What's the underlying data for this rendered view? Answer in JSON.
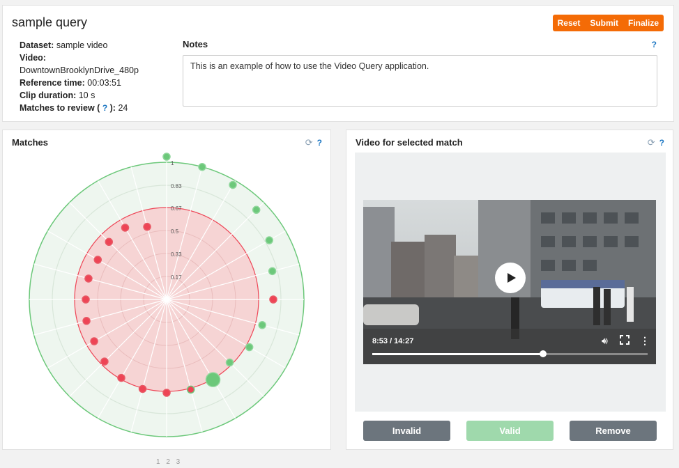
{
  "header": {
    "title": "sample query",
    "buttons": [
      "Reset",
      "Submit",
      "Finalize"
    ],
    "button_color": "#f46b06"
  },
  "meta": {
    "dataset_label": "Dataset:",
    "dataset_value": "sample video",
    "video_label": "Video:",
    "video_value": "DowntownBrooklynDrive_480p",
    "reference_label": "Reference time:",
    "reference_value": "00:03:51",
    "clip_label": "Clip duration:",
    "clip_value": "10 s",
    "matches_label_start": "Matches to review (",
    "matches_help": "?",
    "matches_label_end": "):",
    "matches_value": "24"
  },
  "notes": {
    "label": "Notes",
    "help": "?",
    "text": "This is an example of how to use the Video Query application."
  },
  "matches_panel": {
    "title": "Matches",
    "help": "?",
    "radial_labels": [
      "1",
      "0.83",
      "0.67",
      "0.5",
      "0.33",
      "0.17"
    ],
    "pages": "1 2 3",
    "colors": {
      "valid": "#6cc87a",
      "invalid": "#ee4455",
      "valid_fill": "#eef6ef",
      "invalid_fill": "#f6d4d4"
    }
  },
  "video_panel": {
    "title": "Video for selected match",
    "help": "?",
    "time_display": "8:53 / 14:27",
    "progress": 0.62,
    "buttons": {
      "invalid": "Invalid",
      "valid": "Valid",
      "remove": "Remove"
    },
    "colors": {
      "invalid": "#6c757d",
      "valid": "#9fd9ac",
      "remove": "#6c757d"
    }
  }
}
